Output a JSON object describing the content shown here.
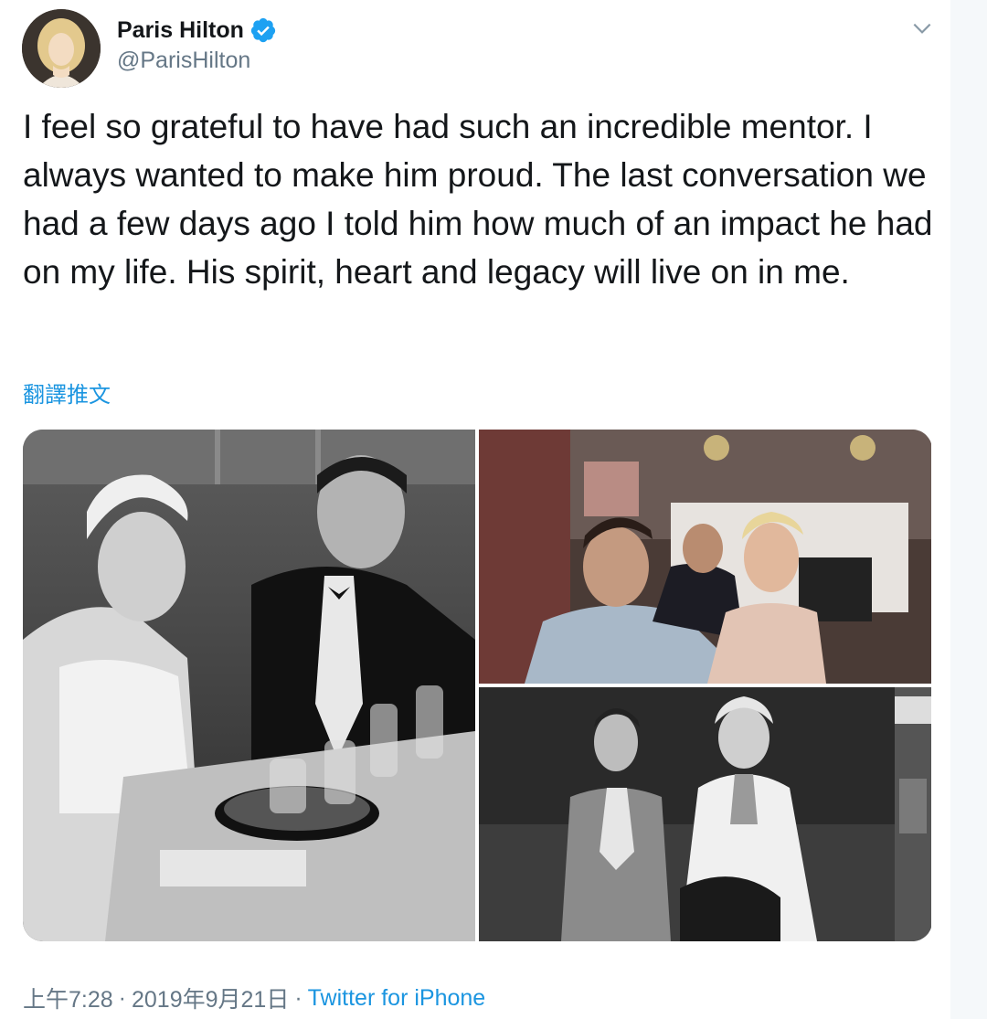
{
  "author": {
    "display_name": "Paris Hilton",
    "handle": "@ParisHilton"
  },
  "tweet": {
    "text": "I feel so grateful to have had such an incredible mentor. I always wanted to make him proud. The last conversation we had a few days ago I told him how much of an impact he had on my life. His spirit, heart and legacy will live on in me.",
    "translate_label": "翻譯推文"
  },
  "meta": {
    "time": "上午7:28",
    "separator1": "·",
    "date": "2019年9月21日",
    "separator2": "·",
    "source": "Twitter for iPhone"
  },
  "icons": {
    "verified": "verified-badge-icon",
    "caret": "chevron-down-icon"
  },
  "colors": {
    "link": "#1b95e0",
    "secondary_text": "#657786",
    "verified": "#1da1f2"
  }
}
